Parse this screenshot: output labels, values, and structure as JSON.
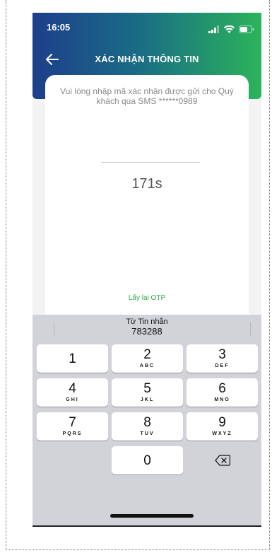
{
  "status_bar": {
    "time": "16:05"
  },
  "header": {
    "title": "XÁC NHẬN THÔNG TIN"
  },
  "otp": {
    "message": "Vui lòng nhập mã xác nhận được gửi cho Quý khách qua SMS ******0989",
    "countdown": "171s",
    "resend_label": "Lấy lại OTP"
  },
  "keyboard": {
    "suggestion_label": "Từ Tin nhắn",
    "suggestion_code": "783288",
    "keys": [
      {
        "num": "1",
        "letters": ""
      },
      {
        "num": "2",
        "letters": "ABC"
      },
      {
        "num": "3",
        "letters": "DEF"
      },
      {
        "num": "4",
        "letters": "GHI"
      },
      {
        "num": "5",
        "letters": "JKL"
      },
      {
        "num": "6",
        "letters": "MNO"
      },
      {
        "num": "7",
        "letters": "PQRS"
      },
      {
        "num": "8",
        "letters": "TUV"
      },
      {
        "num": "9",
        "letters": "WXYZ"
      },
      {
        "num": "0",
        "letters": ""
      }
    ]
  },
  "colors": {
    "accent_green": "#32a852",
    "header_blue": "#1d3f8a",
    "header_green": "#2bb45a"
  },
  "icons": [
    "back-arrow-icon",
    "signal-icon",
    "wifi-icon",
    "battery-icon",
    "backspace-icon"
  ]
}
